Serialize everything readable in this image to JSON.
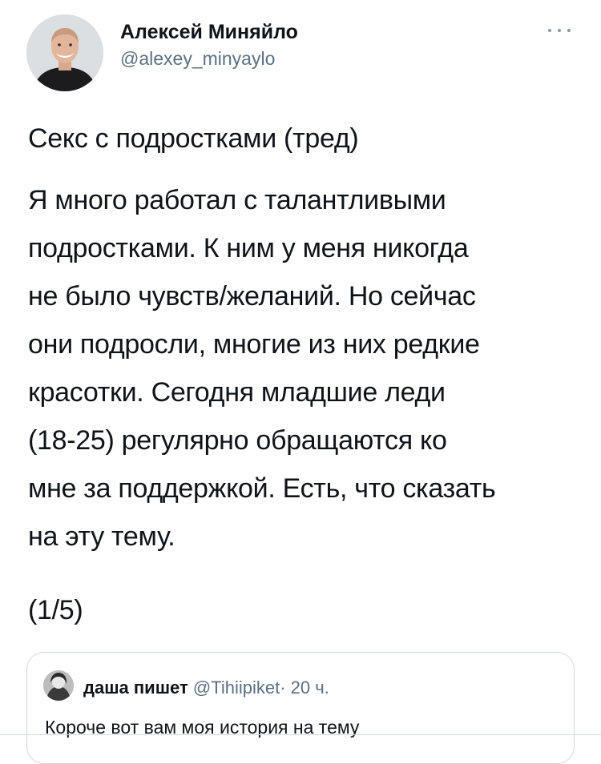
{
  "author": {
    "name": "Алексей Миняйло",
    "handle": "@alexey_minyaylo"
  },
  "tweet": {
    "title": "Секс с подростками (тред)",
    "body": "Я много работал с талантливыми\nподростками. К ним у меня никогда\nне было чувств/желаний. Но сейчас\nони подросли, многие из них редкие\nкрасотки. Сегодня младшие леди\n(18-25) регулярно обращаются ко\nмне за поддержкой. Есть, что сказать\nна эту тему.",
    "counter": "(1/5)"
  },
  "quoted_tweet": {
    "name": "даша пишет",
    "handle": "@Tihiipiket",
    "separator": "·",
    "time": "20 ч.",
    "text": "Короче вот вам моя история на тему"
  },
  "icons": {
    "more": "more-horizontal-icon"
  },
  "colors": {
    "text": "#0f1419",
    "secondary": "#5b7083",
    "border": "#cfd9de"
  }
}
